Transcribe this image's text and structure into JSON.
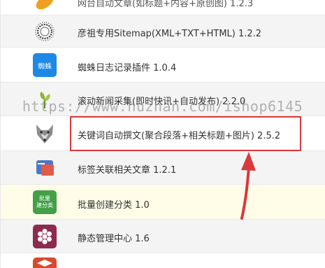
{
  "plugins": [
    {
      "label": "网台自动文章(如标题+内容+原创图) 1.2.3",
      "icon": "orange-leaf-icon"
    },
    {
      "label": "彦祖专用Sitemap(XML+TXT+HTML) 1.2.2",
      "icon": "spiky-ring-icon"
    },
    {
      "label": "蜘蛛日志记录插件 1.0.4",
      "icon": "spider-log-icon",
      "icon_text": "蜘蛛"
    },
    {
      "label": "滚动新闻采集(即时快讯+自动发布) 2.2.0",
      "icon": "sprout-icon"
    },
    {
      "label": "关键词自动撰文(聚合段落+相关标题+图片) 2.5.2",
      "icon": "wolf-icon"
    },
    {
      "label": "标签关联相关文章 1.2.1",
      "icon": "tag-card-icon"
    },
    {
      "label": "批量创建分类 1.0",
      "icon": "batch-category-icon",
      "icon_text_1": "批量",
      "icon_text_2": "建分类"
    },
    {
      "label": "静态管理中心 1.6",
      "icon": "hexagon-flower-icon"
    }
  ],
  "watermark": "https://www.huzhan.com/ishop6145",
  "colors": {
    "callout": "#d9393c",
    "spider_blue": "#1e88e5",
    "batch_green": "#43a047",
    "hex_maroon": "#8e2a4f"
  }
}
